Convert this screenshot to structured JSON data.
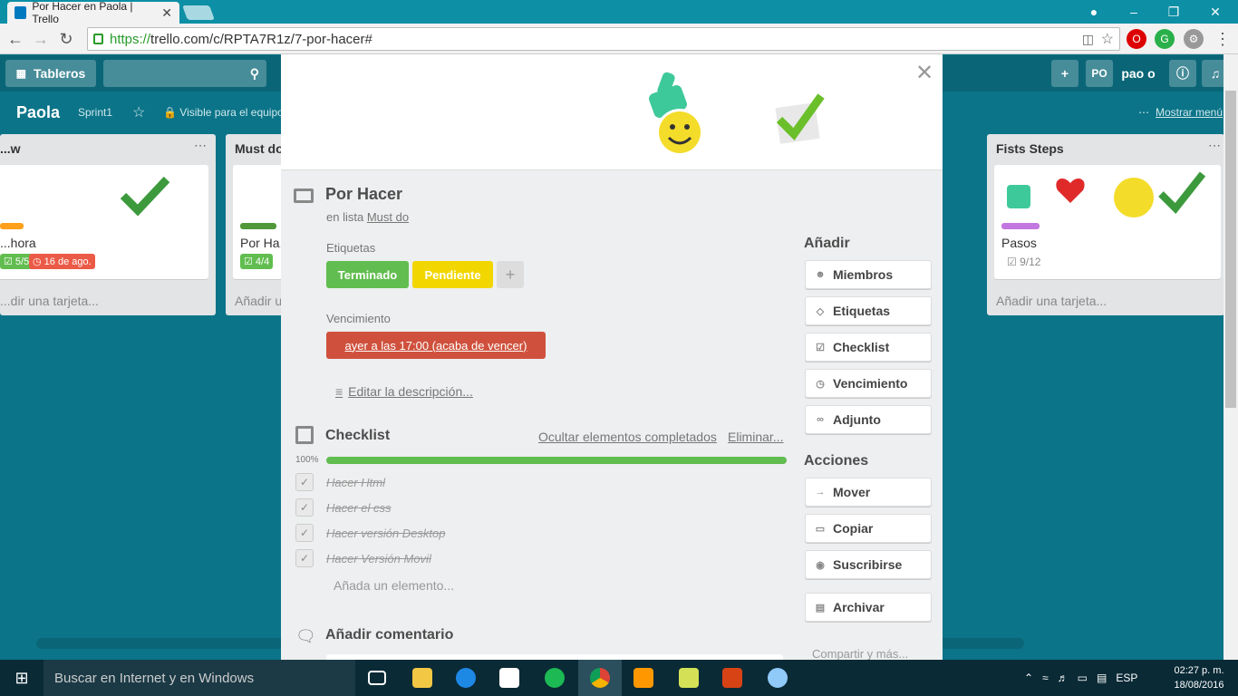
{
  "browser": {
    "tab_title": "Por Hacer en Paola | Trello",
    "url_secure": "https://",
    "url_rest": "trello.com/c/RPTA7R1z/7-por-hacer#"
  },
  "trello_header": {
    "boards_label": "Tableros",
    "search_placeholder": "",
    "user_initials": "PO",
    "user_name": "pao o"
  },
  "board": {
    "name": "Paola",
    "team": "Sprint1",
    "visibility": "Visible para el equipo",
    "menu_label": "Mostrar menú"
  },
  "lists": [
    {
      "title": "...w",
      "card_title": "...hora",
      "badge_check": "5/5",
      "badge_due": "16 de ago.",
      "add_label": "...dir una tarjeta..."
    },
    {
      "title": "Must do",
      "card_title": "Por Ha...",
      "badge_check": "4/4",
      "add_label": "Añadir u..."
    },
    {
      "title": "Fists Steps",
      "card_title": "Pasos",
      "badge_check": "9/12",
      "add_label": "Añadir una tarjeta..."
    }
  ],
  "card": {
    "title": "Por Hacer",
    "in_list_prefix": "en lista",
    "in_list_name": "Must do",
    "labels_heading": "Etiquetas",
    "labels": [
      {
        "text": "Terminado",
        "color": "#61bd4f"
      },
      {
        "text": "Pendiente",
        "color": "#f2d600"
      }
    ],
    "add_label_symbol": "+",
    "due_heading": "Vencimiento",
    "due_text": "ayer a las 17:00 (acaba de vencer)",
    "edit_description": "Editar la descripción...",
    "checklist": {
      "title": "Checklist",
      "hide_completed": "Ocultar elementos completados",
      "delete": "Eliminar...",
      "percent_label": "100%",
      "progress": 1.0,
      "items": [
        "Hacer Html",
        "Hacer el css",
        "Hacer versión Desktop",
        "Hacer Versión Movil"
      ],
      "add_item": "Añada un elemento..."
    },
    "comment_title": "Añadir comentario"
  },
  "sidebar": {
    "add_heading": "Añadir",
    "add_buttons": [
      {
        "label": "Miembros",
        "icon": "person-icon"
      },
      {
        "label": "Etiquetas",
        "icon": "tag-icon"
      },
      {
        "label": "Checklist",
        "icon": "checkbox-icon"
      },
      {
        "label": "Vencimiento",
        "icon": "clock-icon"
      },
      {
        "label": "Adjunto",
        "icon": "paperclip-icon"
      }
    ],
    "actions_heading": "Acciones",
    "action_buttons": [
      {
        "label": "Mover",
        "icon": "arrow-right-icon"
      },
      {
        "label": "Copiar",
        "icon": "card-icon"
      },
      {
        "label": "Suscribirse",
        "icon": "eye-icon"
      },
      {
        "label": "Archivar",
        "icon": "archive-icon"
      }
    ],
    "share_label": "Compartir y más..."
  },
  "taskbar": {
    "search_text": "Buscar en Internet y en Windows",
    "language": "ESP",
    "time": "02:27 p. m.",
    "date": "18/08/2016"
  }
}
